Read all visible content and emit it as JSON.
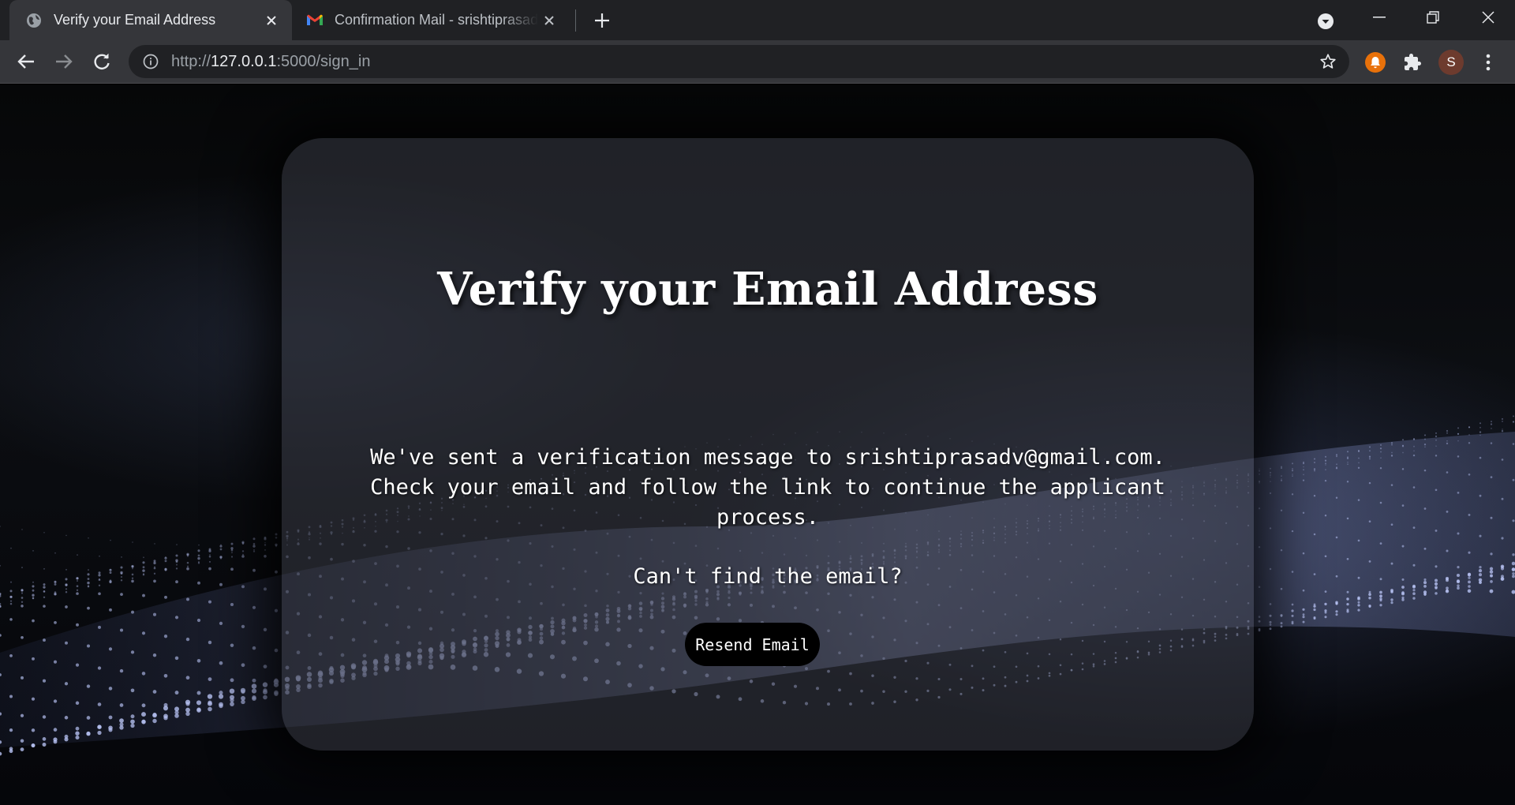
{
  "browser": {
    "tabs": [
      {
        "title": "Verify your Email Address",
        "favicon": "globe-icon",
        "active": true
      },
      {
        "title": "Confirmation Mail - srishtiprasadv@gmail.com",
        "favicon": "gmail-icon",
        "active": false
      }
    ],
    "address_bar": {
      "scheme": "http://",
      "host": "127.0.0.1",
      "rest": ":5000/sign_in"
    },
    "profile_initial": "S"
  },
  "page": {
    "title": "Verify your Email Address",
    "message": "We've sent a verification message to srishtiprasadv@gmail.com. Check your email and follow the link to continue the applicant process.",
    "question": "Can't find the email?",
    "resend_label": "Resend Email"
  },
  "colors": {
    "chrome_dark": "#202124",
    "chrome_light": "#35363a",
    "button_bg": "#000000",
    "text": "#ffffff"
  }
}
